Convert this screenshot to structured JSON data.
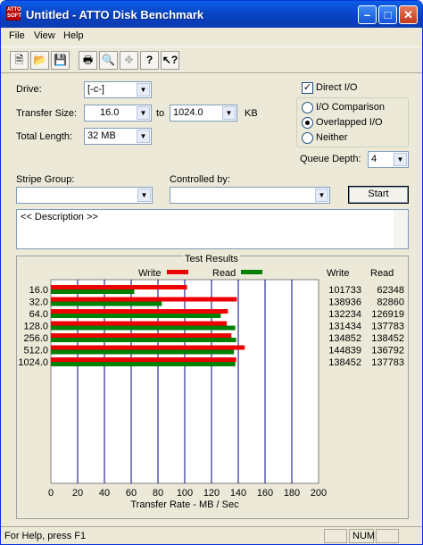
{
  "window": {
    "title": "Untitled - ATTO Disk Benchmark",
    "app_icon_text": "ATTO SOFT"
  },
  "menu": [
    {
      "label": "File"
    },
    {
      "label": "View"
    },
    {
      "label": "Help"
    }
  ],
  "toolbar": {
    "icons": [
      "new-icon",
      "open-icon",
      "save-icon",
      "print-icon",
      "print-preview-icon",
      "move-icon",
      "help-icon",
      "context-help-icon"
    ]
  },
  "settings": {
    "drive_label": "Drive:",
    "drive_value": "[-c-]",
    "transfer_size_label": "Transfer Size:",
    "transfer_from": "16.0",
    "to_label": "to",
    "transfer_to": "1024.0",
    "kb_label": "KB",
    "total_length_label": "Total Length:",
    "total_length_value": "32 MB",
    "direct_io_label": "Direct I/O",
    "direct_io_checked": true,
    "io_comparison_label": "I/O Comparison",
    "overlapped_io_label": "Overlapped I/O",
    "neither_label": "Neither",
    "queue_depth_label": "Queue Depth:",
    "queue_depth_value": "4",
    "stripe_group_label": "Stripe Group:",
    "controlled_by_label": "Controlled by:",
    "start_label": "Start",
    "description": "<< Description >>"
  },
  "results": {
    "title": "Test Results",
    "legend_write": "Write",
    "legend_read": "Read",
    "col_write": "Write",
    "col_read": "Read",
    "colors": {
      "write": "#ee0000",
      "read": "#008000",
      "grid": "#000080"
    }
  },
  "chart_data": {
    "type": "bar",
    "categories": [
      "16.0",
      "32.0",
      "64.0",
      "128.0",
      "256.0",
      "512.0",
      "1024.0"
    ],
    "series": [
      {
        "name": "Write",
        "values": [
          101733,
          138936,
          132234,
          131434,
          134852,
          144839,
          138452
        ]
      },
      {
        "name": "Read",
        "values": [
          62348,
          82860,
          126919,
          137783,
          138452,
          136792,
          137783
        ]
      }
    ],
    "xlabel": "Transfer Rate - MB / Sec",
    "x_ticks": [
      "0",
      "20",
      "40",
      "60",
      "80",
      "100",
      "120",
      "140",
      "160",
      "180",
      "200"
    ],
    "xlim": [
      0,
      200
    ],
    "grid": true,
    "legend": "top"
  },
  "status": {
    "help_text": "For Help, press F1",
    "num": "NUM"
  }
}
